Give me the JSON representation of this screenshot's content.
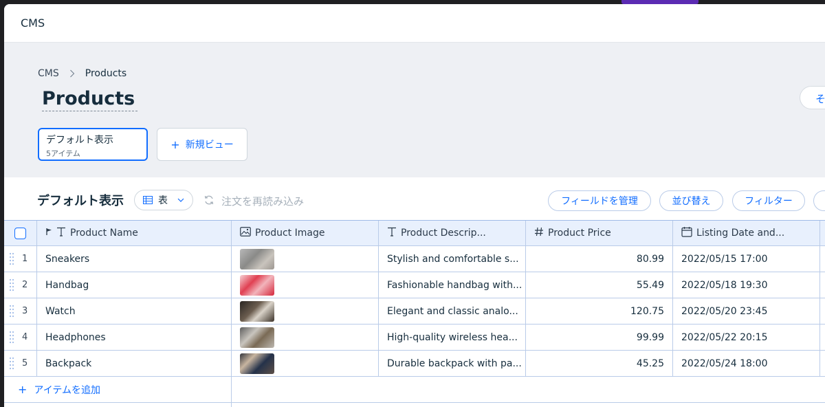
{
  "window": {
    "title": "CMS"
  },
  "breadcrumb": {
    "root": "CMS",
    "current": "Products"
  },
  "page": {
    "title": "Products",
    "right_button_label": "そ"
  },
  "views": {
    "default": {
      "name": "デフォルト表示",
      "count": "5アイテム"
    },
    "new_view_label": "新規ビュー"
  },
  "toolbar": {
    "title": "デフォルト表示",
    "view_type": "表",
    "reload_label": "注文を再読み込み",
    "manage_fields": "フィールドを管理",
    "sort": "並び替え",
    "filter": "フィルター"
  },
  "table": {
    "columns": [
      {
        "label": "Product Name",
        "icon": "text-icon"
      },
      {
        "label": "Product Image",
        "icon": "image-icon"
      },
      {
        "label": "Product Descrip...",
        "icon": "text-icon"
      },
      {
        "label": "Product Price",
        "icon": "number-icon"
      },
      {
        "label": "Listing Date and...",
        "icon": "calendar-icon"
      }
    ],
    "rows": [
      {
        "num": "1",
        "name": "Sneakers",
        "desc": "Stylish and comfortable s...",
        "price": "80.99",
        "date": "2022/05/15 17:00"
      },
      {
        "num": "2",
        "name": "Handbag",
        "desc": "Fashionable handbag with...",
        "price": "55.49",
        "date": "2022/05/18 19:30"
      },
      {
        "num": "3",
        "name": "Watch",
        "desc": "Elegant and classic analo...",
        "price": "120.75",
        "date": "2022/05/20 23:45"
      },
      {
        "num": "4",
        "name": "Headphones",
        "desc": "High-quality wireless hea...",
        "price": "99.99",
        "date": "2022/05/22 20:15"
      },
      {
        "num": "5",
        "name": "Backpack",
        "desc": "Durable backpack with pa...",
        "price": "45.25",
        "date": "2022/05/24 18:00"
      }
    ],
    "add_item_label": "アイテムを追加"
  },
  "colors": {
    "accent": "#116dff",
    "header_bg": "#eef0f4",
    "grid_line": "#b9cbe8"
  }
}
